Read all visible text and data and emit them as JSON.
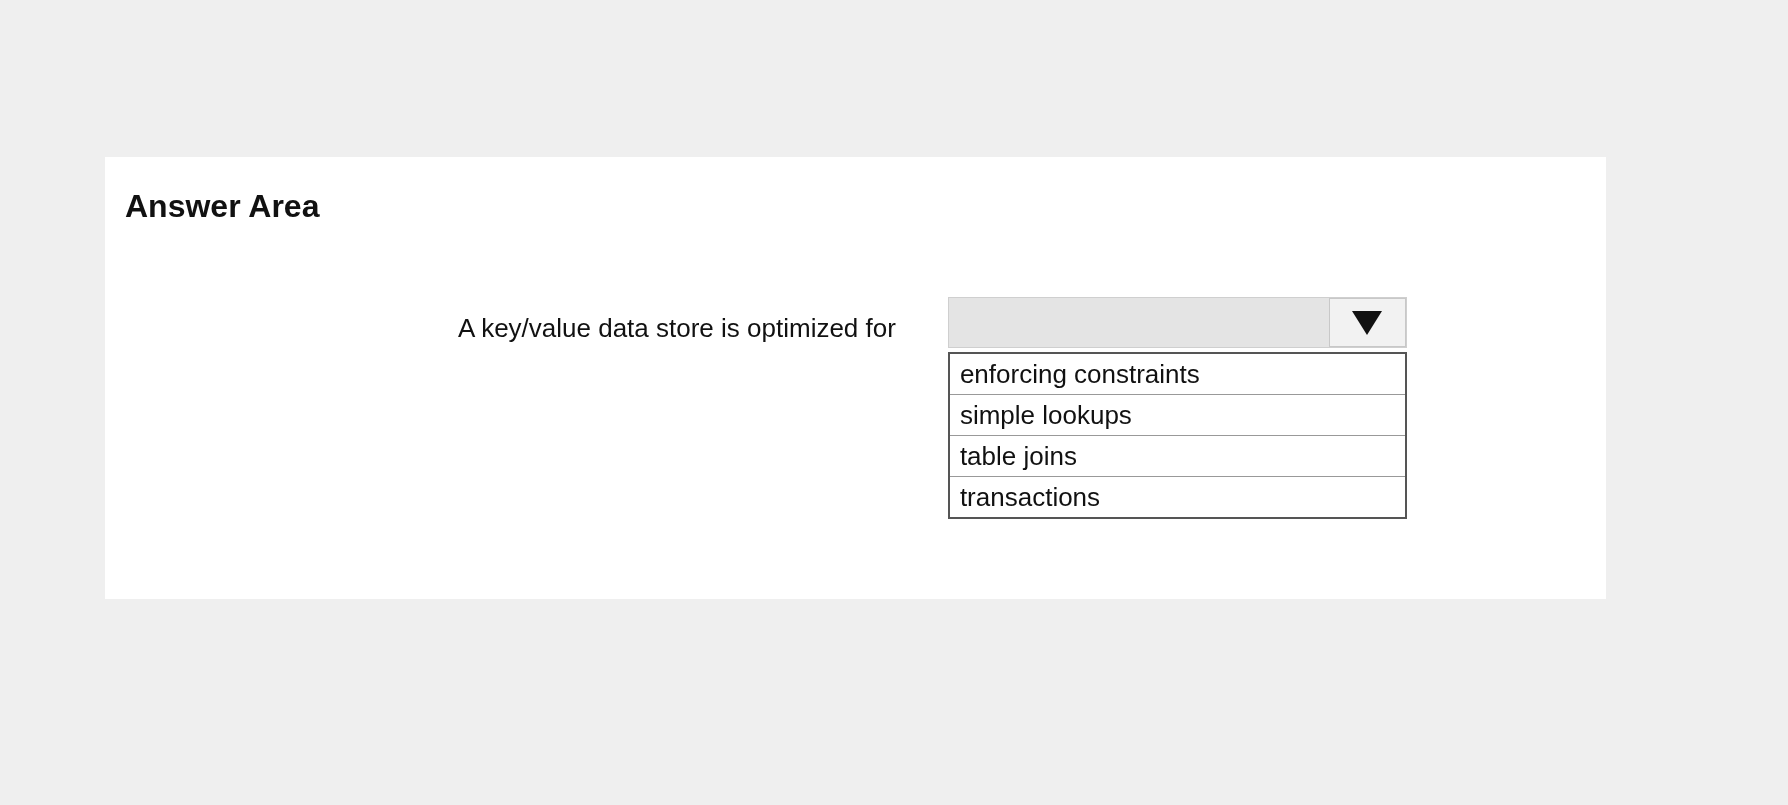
{
  "title": "Answer Area",
  "question": {
    "prompt": "A key/value data store is optimized for",
    "dropdown": {
      "expanded": true,
      "options": [
        {
          "label": "enforcing constraints",
          "selected": false
        },
        {
          "label": "simple lookups",
          "selected": false
        },
        {
          "label": "table joins",
          "selected": false
        },
        {
          "label": "transactions",
          "selected": false
        }
      ]
    }
  }
}
